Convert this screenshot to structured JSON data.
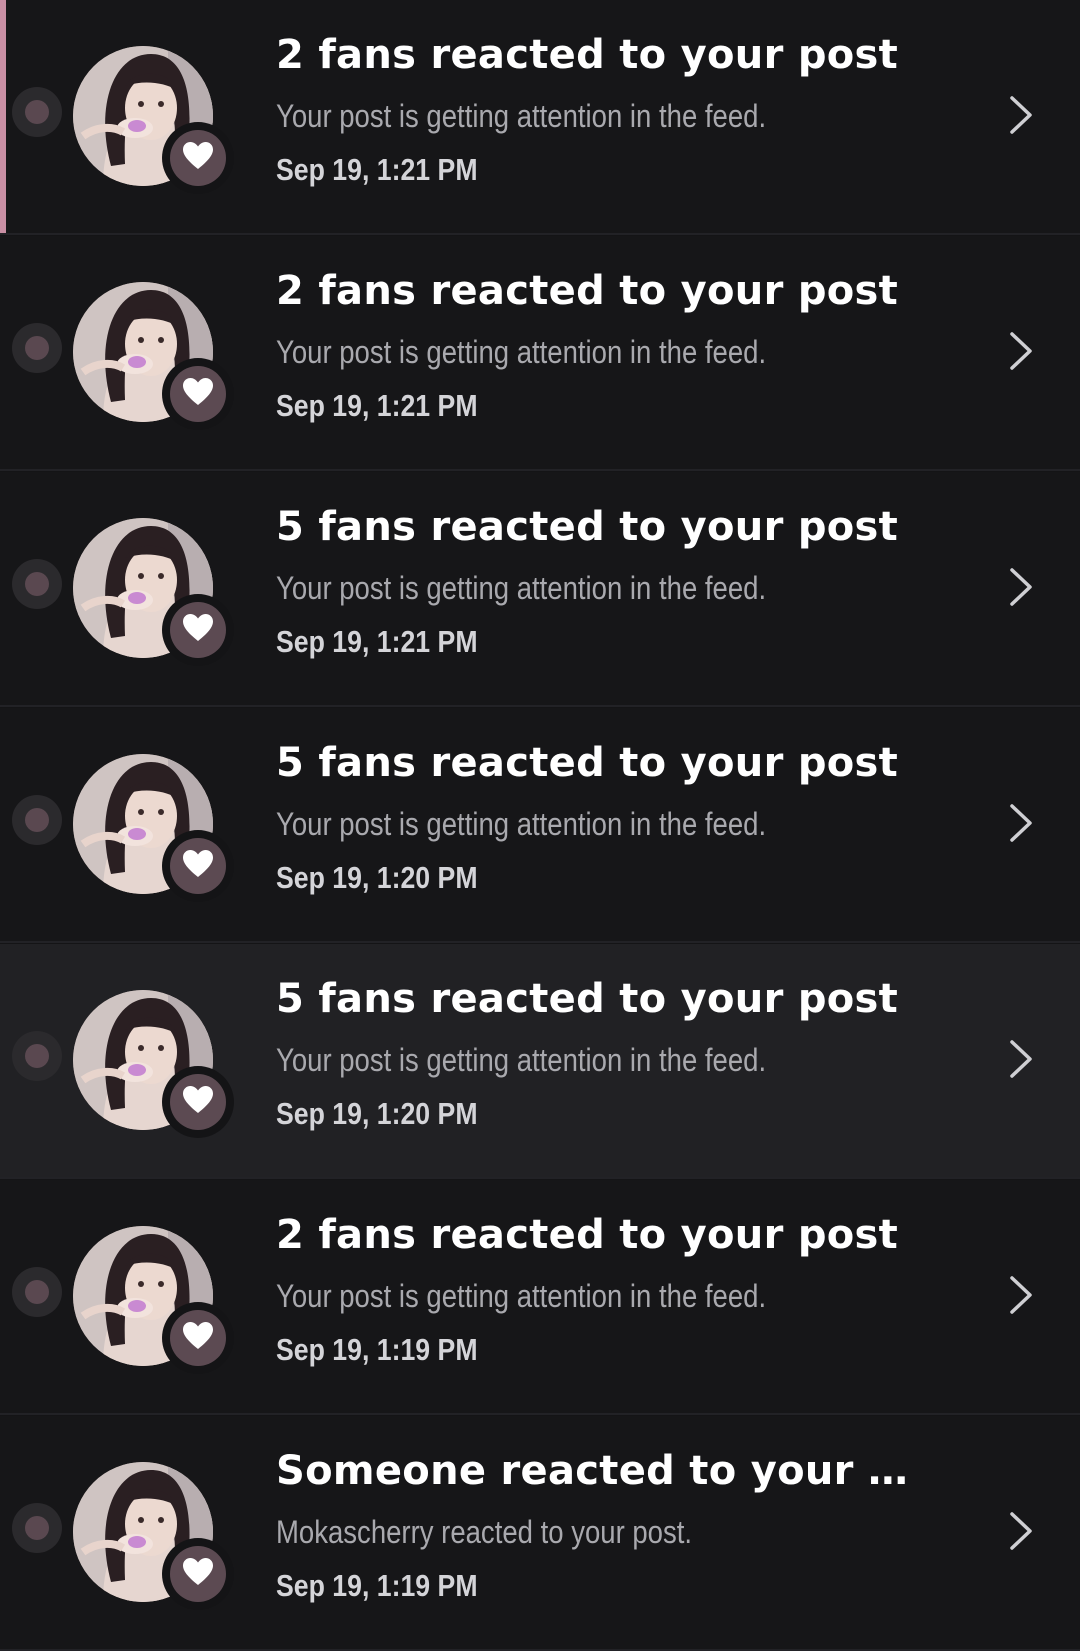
{
  "notifications": [
    {
      "title": "2 fans reacted to your post",
      "subtitle": "Your post is getting attention in the feed.",
      "timestamp": "Sep 19, 1:21 PM",
      "selected": true,
      "highlighted": false
    },
    {
      "title": "2 fans reacted to your post",
      "subtitle": "Your post is getting attention in the feed.",
      "timestamp": "Sep 19, 1:21 PM",
      "selected": false,
      "highlighted": false
    },
    {
      "title": "5 fans reacted to your post",
      "subtitle": "Your post is getting attention in the feed.",
      "timestamp": "Sep 19, 1:21 PM",
      "selected": false,
      "highlighted": false
    },
    {
      "title": "5 fans reacted to your post",
      "subtitle": "Your post is getting attention in the feed.",
      "timestamp": "Sep 19, 1:20 PM",
      "selected": false,
      "highlighted": false
    },
    {
      "title": "5 fans reacted to your post",
      "subtitle": "Your post is getting attention in the feed.",
      "timestamp": "Sep 19, 1:20 PM",
      "selected": false,
      "highlighted": true
    },
    {
      "title": "2 fans reacted to your post",
      "subtitle": "Your post is getting attention in the feed.",
      "timestamp": "Sep 19, 1:19 PM",
      "selected": false,
      "highlighted": false
    },
    {
      "title": "Someone reacted to your p...",
      "subtitle": "Mokascherry reacted to your post.",
      "timestamp": "Sep 19, 1:19 PM",
      "selected": false,
      "highlighted": false
    }
  ],
  "icons": {
    "badge": "heart-icon",
    "row_action": "chevron-right-icon",
    "status": "unread-dot-icon"
  },
  "colors": {
    "background": "#161618",
    "highlight_background": "#212124",
    "selected_accent": "#c98fa4",
    "badge": "#5c4a52",
    "title": "#ffffff",
    "subtitle": "#a9a9ae",
    "timestamp": "#d4d4d8"
  }
}
